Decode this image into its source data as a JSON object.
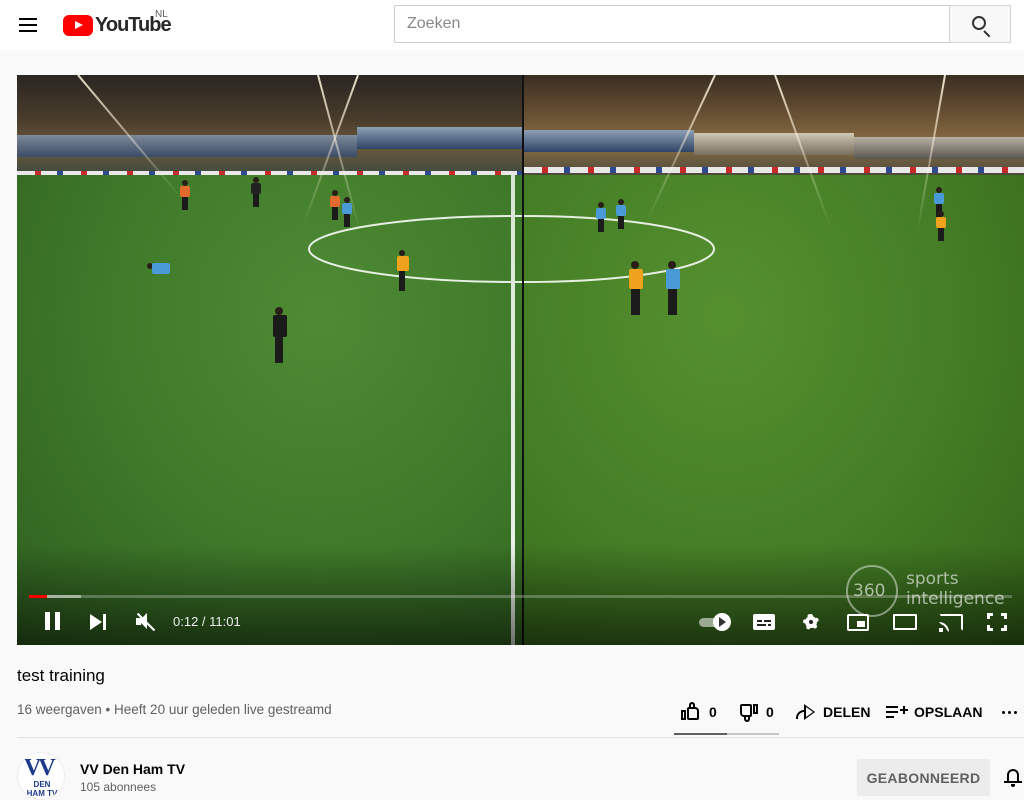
{
  "header": {
    "logo_text": "YouTube",
    "country_code": "NL",
    "search_placeholder": "Zoeken",
    "search_value": ""
  },
  "player": {
    "current_time": "0:12",
    "duration": "11:01",
    "time_display": "0:12 / 11:01",
    "progress_fraction": 0.018,
    "buffer_fraction": 0.053,
    "watermark_number": "360",
    "watermark_line1": "sports",
    "watermark_line2": "intelligence",
    "state": "playing",
    "muted": true
  },
  "video": {
    "title": "test training",
    "meta": "16 weergaven • Heeft 20 uur geleden live gestreamd",
    "likes": "0",
    "dislikes": "0",
    "share_label": "DELEN",
    "save_label": "OPSLAAN"
  },
  "channel": {
    "name": "VV Den Ham TV",
    "subscribers": "105 abonnees",
    "avatar_letters": "VV",
    "avatar_text": "DEN HAM TV",
    "subscribe_label": "GEABONNEERD"
  },
  "colors": {
    "brand_red": "#ff0000",
    "text_primary": "#030303",
    "text_secondary": "#606060",
    "background": "#f9f9f9",
    "subscribe_bg": "#ececec"
  },
  "icons": [
    "menu-icon",
    "youtube-logo-icon",
    "search-icon",
    "pause-icon",
    "next-icon",
    "mute-icon",
    "autoplay-toggle-icon",
    "subtitles-icon",
    "settings-icon",
    "miniplayer-icon",
    "theater-icon",
    "cast-icon",
    "fullscreen-icon",
    "like-icon",
    "dislike-icon",
    "share-icon",
    "save-icon",
    "more-icon",
    "bell-icon"
  ]
}
